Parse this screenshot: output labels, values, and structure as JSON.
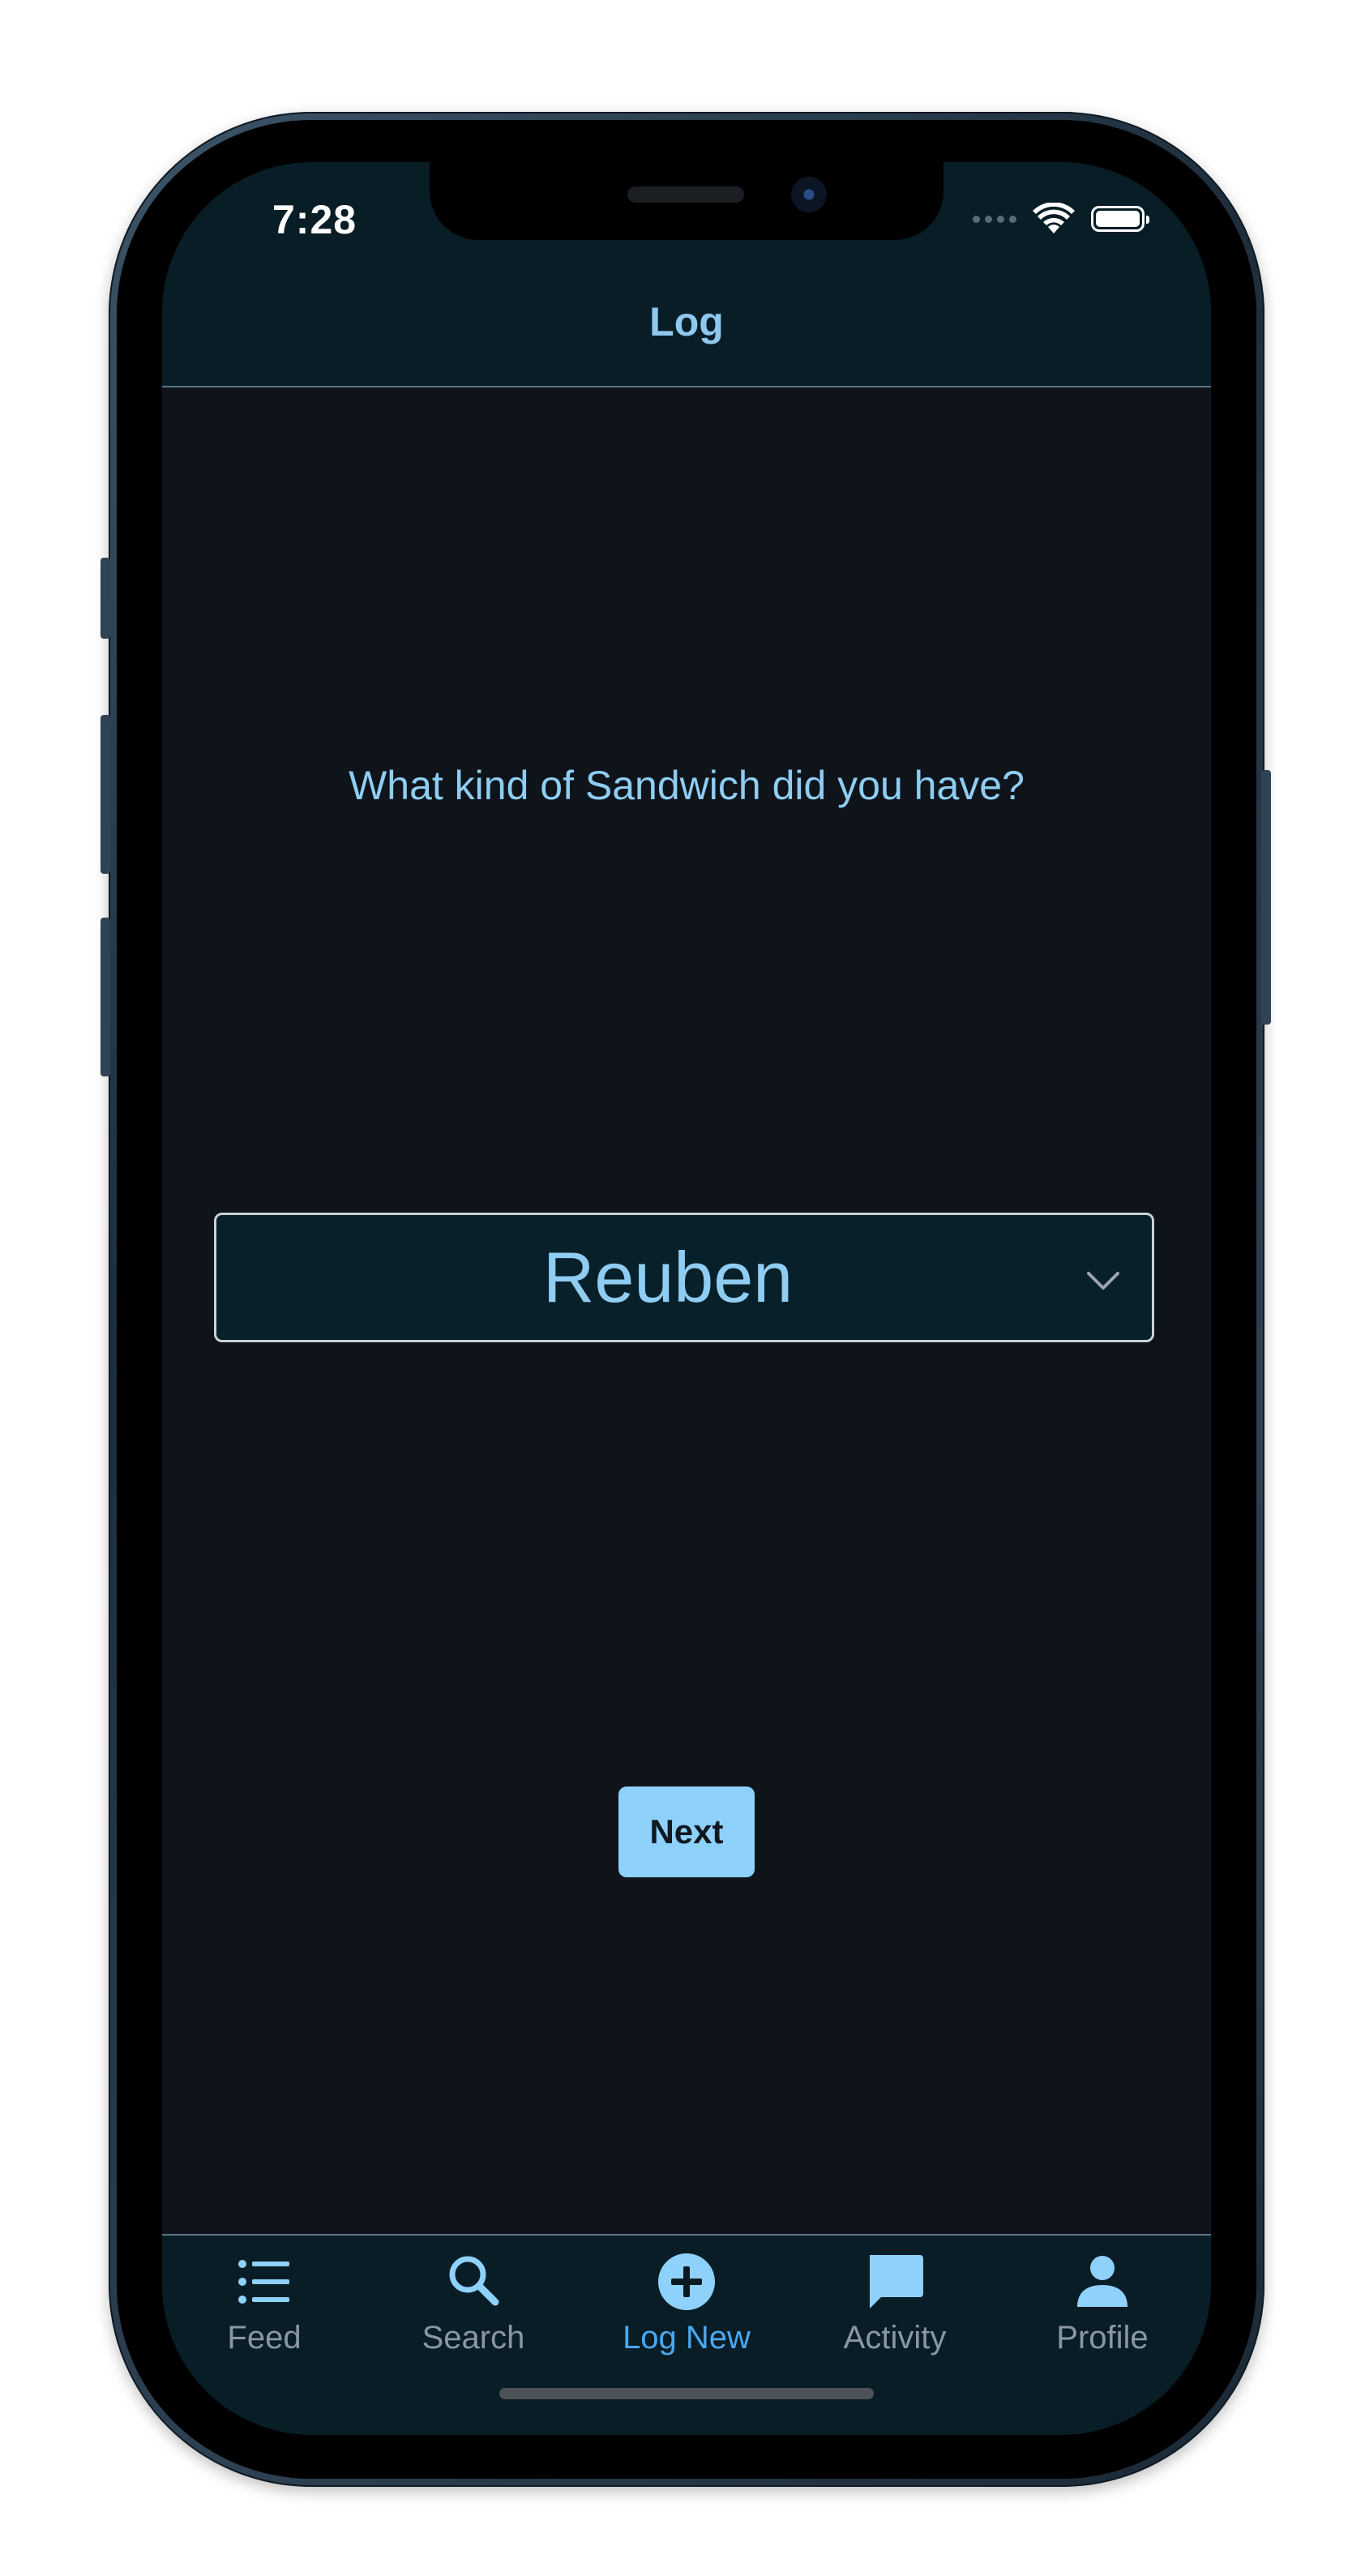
{
  "status_bar": {
    "time": "7:28"
  },
  "header": {
    "title": "Log"
  },
  "prompt": {
    "question": "What kind of Sandwich did you have?"
  },
  "sandwich_select": {
    "selected": "Reuben"
  },
  "actions": {
    "next_label": "Next"
  },
  "tab_bar": {
    "items": [
      {
        "label": "Feed",
        "icon": "list-icon"
      },
      {
        "label": "Search",
        "icon": "search-icon"
      },
      {
        "label": "Log New",
        "icon": "plus-circle-icon",
        "active": true
      },
      {
        "label": "Activity",
        "icon": "chat-bubble-icon"
      },
      {
        "label": "Profile",
        "icon": "person-icon"
      }
    ]
  },
  "colors": {
    "accent": "#8ed1fb",
    "active_tab": "#4ba7ee",
    "inactive_tab": "#8b96a0",
    "background": "#0e141a",
    "bar_background": "#081d26"
  }
}
